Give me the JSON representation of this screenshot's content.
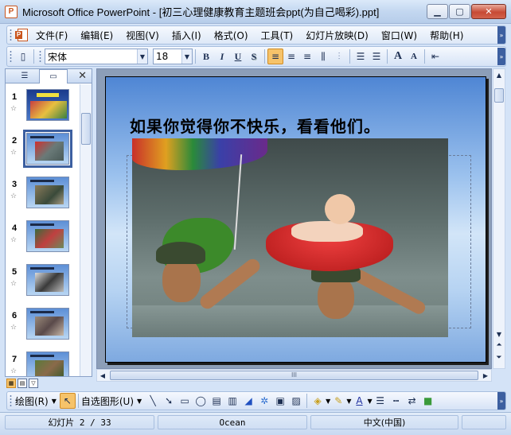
{
  "window": {
    "app_icon": "powerpoint-icon",
    "title": "Microsoft Office PowerPoint - [初三心理健康教育主题班会ppt(为自己喝彩).ppt]",
    "min_glyph": "▭",
    "max_glyph": "▢",
    "close_glyph": "✕"
  },
  "menu": {
    "items": [
      "文件(F)",
      "编辑(E)",
      "视图(V)",
      "插入(I)",
      "格式(O)",
      "工具(T)",
      "幻灯片放映(D)",
      "窗口(W)",
      "帮助(H)"
    ]
  },
  "toolbar": {
    "font_name": "宋体",
    "font_size": "18",
    "bold": "B",
    "italic": "I",
    "underline": "U",
    "shadow": "S",
    "grow_font": "A",
    "shrink_font": "A"
  },
  "left_pane": {
    "slides": [
      {
        "number": "1"
      },
      {
        "number": "2",
        "selected": true
      },
      {
        "number": "3"
      },
      {
        "number": "4"
      },
      {
        "number": "5"
      },
      {
        "number": "6"
      },
      {
        "number": "7"
      }
    ],
    "close_glyph": "✕"
  },
  "slide": {
    "title": "如果你觉得你不快乐，看看他们。"
  },
  "hscroll_grip": "III",
  "drawing_toolbar": {
    "draw_label": "绘图(R)",
    "autoshapes_label": "自选图形(U)"
  },
  "status": {
    "slide_position": "幻灯片 2 / 33",
    "design": "Ocean",
    "language": "中文(中国)"
  }
}
